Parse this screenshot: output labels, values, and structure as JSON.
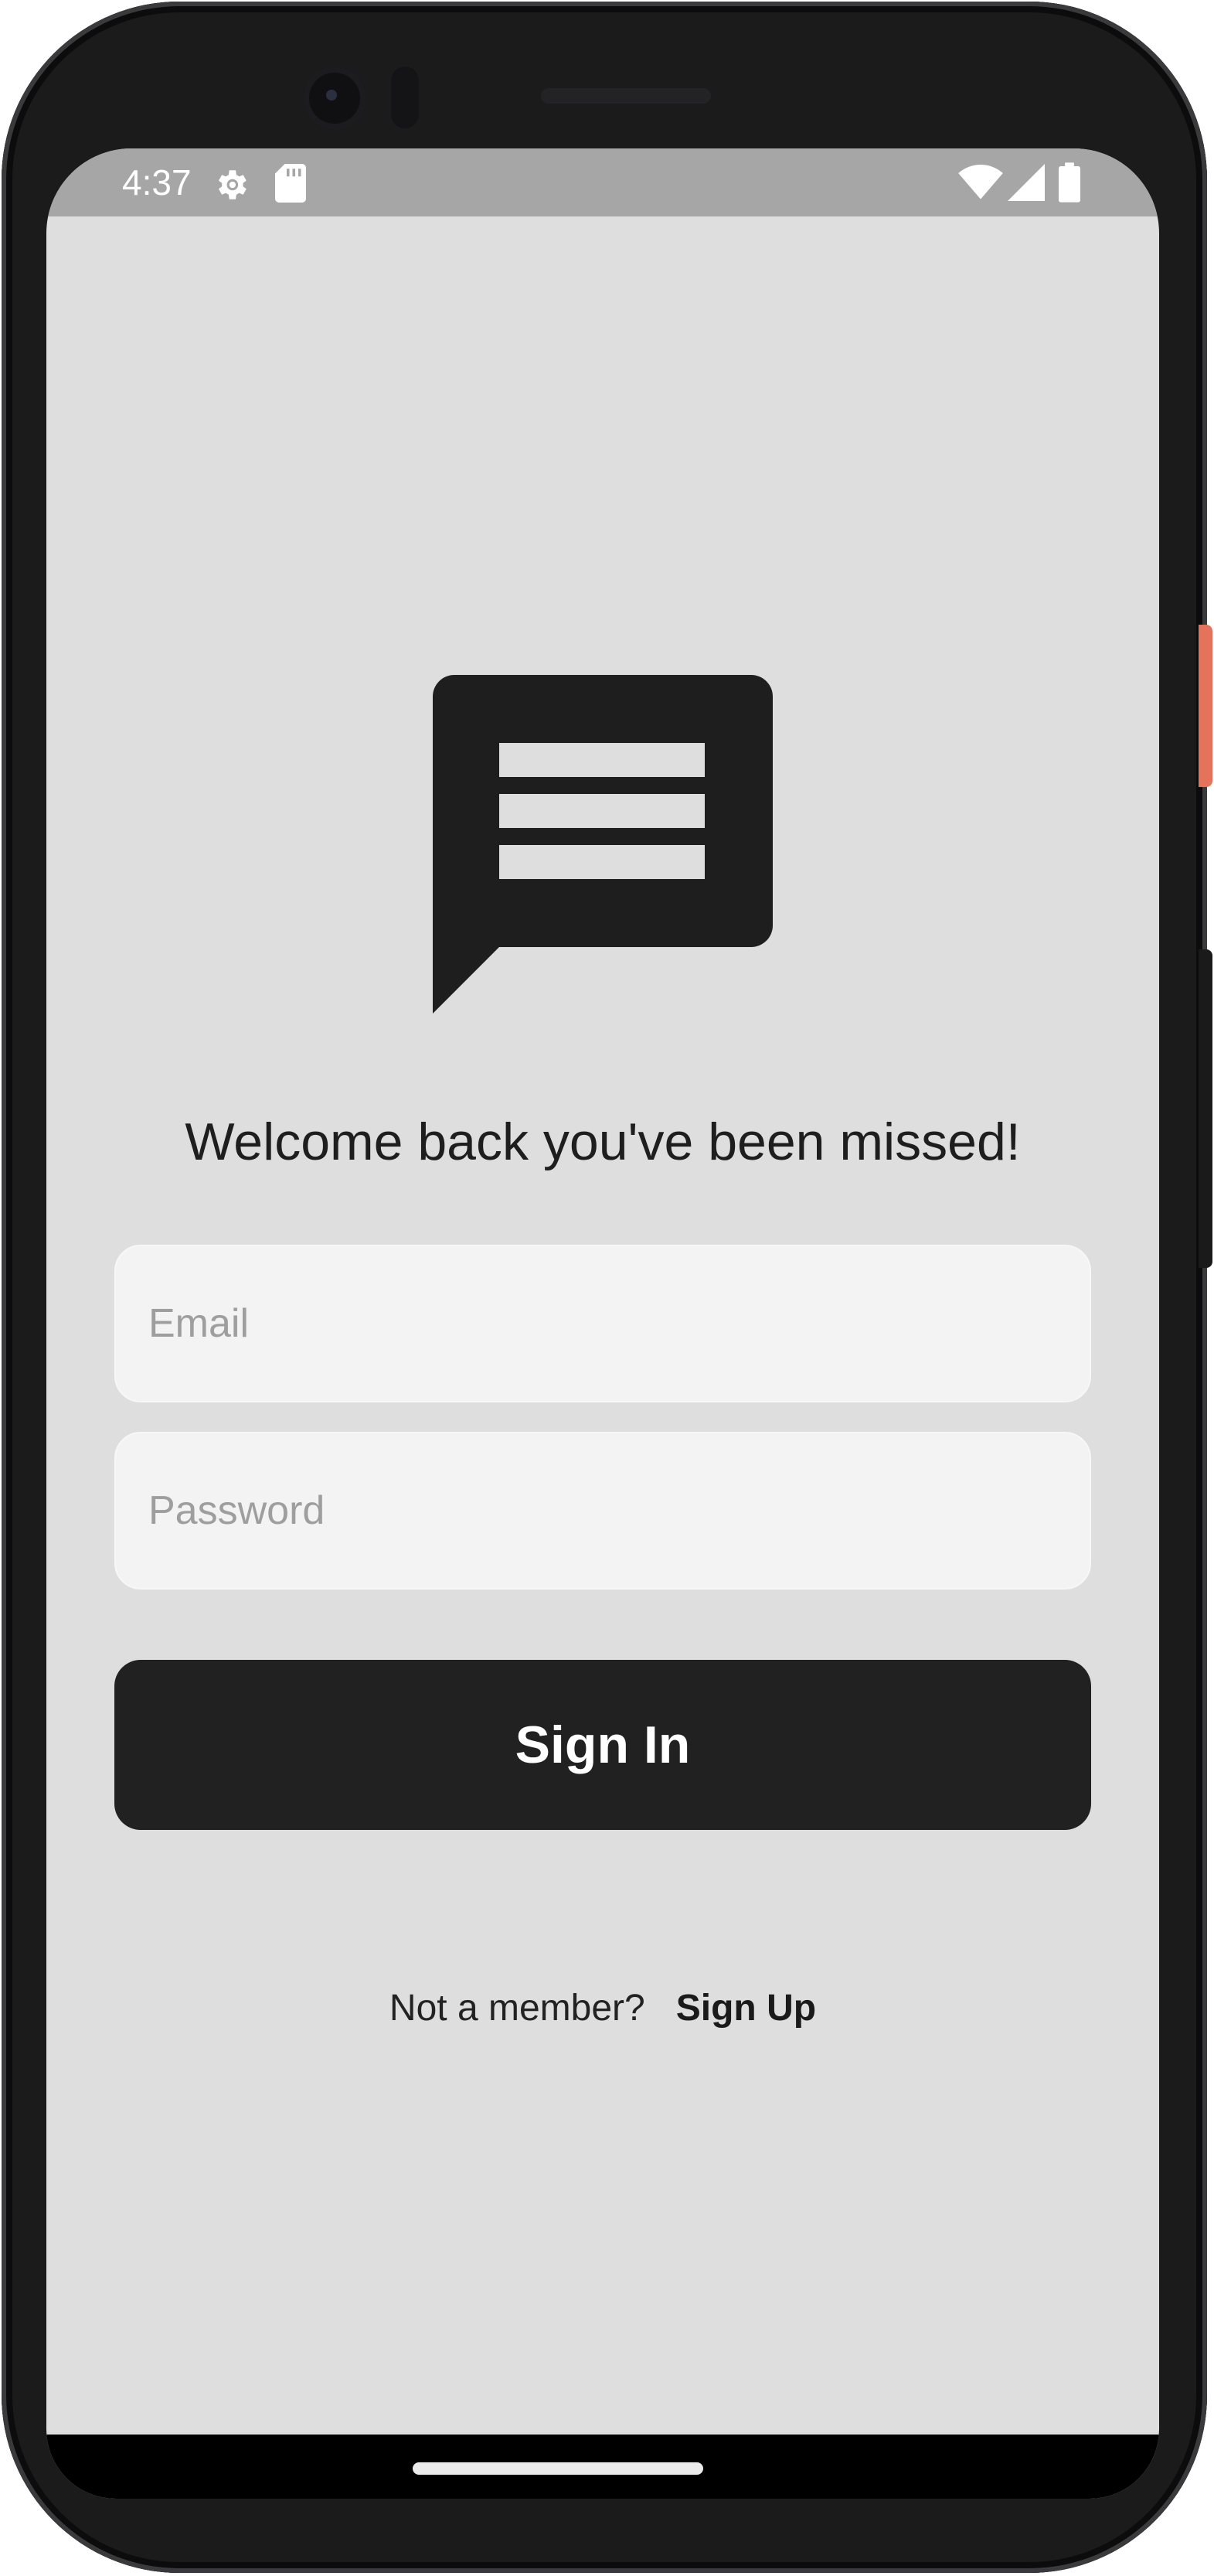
{
  "status_bar": {
    "time": "4:37",
    "left_icons": [
      "settings-gear-icon",
      "sd-card-icon"
    ],
    "right_icons": [
      "wifi-icon",
      "cellular-signal-icon",
      "battery-icon"
    ]
  },
  "logo": {
    "icon": "chat-message-icon",
    "color": "#1e1e1e"
  },
  "welcome_text": "Welcome back you've been missed!",
  "email_field": {
    "placeholder": "Email",
    "value": ""
  },
  "password_field": {
    "placeholder": "Password",
    "value": ""
  },
  "sign_in_button": {
    "label": "Sign In"
  },
  "footer": {
    "prompt": "Not a member?",
    "link_label": "Sign Up"
  },
  "colors": {
    "screen_background": "#dedede",
    "status_bar": "#a6a6a6",
    "button": "#212121",
    "field_background": "#f3f3f3",
    "text": "#1e1e1e"
  }
}
